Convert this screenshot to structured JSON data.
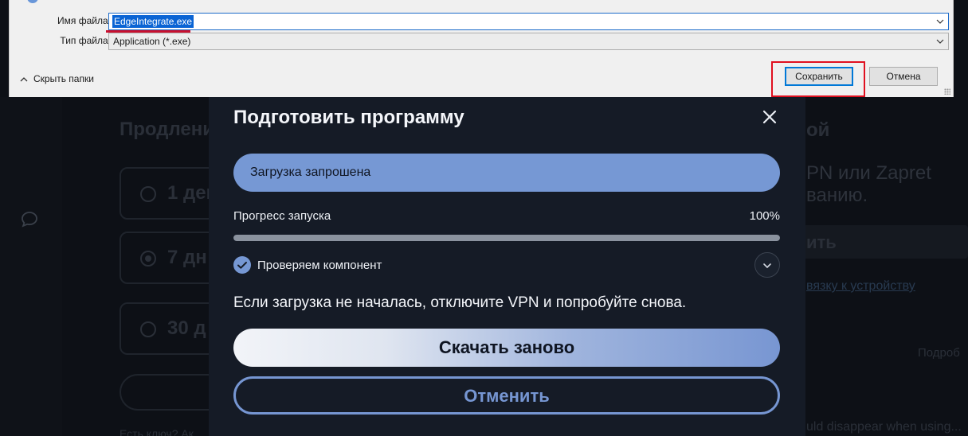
{
  "save_dialog": {
    "filename_label": "Имя файла:",
    "filename_value": "EdgeIntegrate.exe",
    "filetype_label": "Тип файла:",
    "filetype_value": "Application (*.exe)",
    "hide_folders_label": "Скрыть папки",
    "save_button": "Сохранить",
    "cancel_button": "Отмена"
  },
  "modal": {
    "title": "Подготовить программу",
    "status": "Загрузка запрошена",
    "progress_label": "Прогресс запуска",
    "progress_percent_text": "100%",
    "progress_fraction": 1.0,
    "check_item": "Проверяем компонент",
    "hint": "Если загрузка не началась, отключите VPN и попробуйте снова.",
    "retry_button": "Скачать заново",
    "cancel_button": "Отменить"
  },
  "background": {
    "left_heading": "Продлени",
    "options": [
      {
        "label": "1 ден",
        "selected": false
      },
      {
        "label": "7 дн",
        "selected": true
      },
      {
        "label": "30 д",
        "selected": false
      }
    ],
    "key_text": "Есть ключ? Ак",
    "right_heading": "ой",
    "right_text_line1": "PN или Zapret",
    "right_text_line2": "ванию.",
    "right_button": "ить",
    "right_link": "вязку к устройству",
    "right_more": "Подроб",
    "right_disappear": "uld disappear when using..."
  },
  "colors": {
    "accent": "#7698d4",
    "modal_bg": "#151b26",
    "save_highlight": "#e01020",
    "selection_blue": "#0a64d4"
  },
  "icons": {
    "close": "close-icon",
    "check": "check-circle-icon",
    "expand": "chevron-down-icon",
    "chat": "chat-bubble-icon",
    "hide_folders": "chevron-up-icon"
  }
}
